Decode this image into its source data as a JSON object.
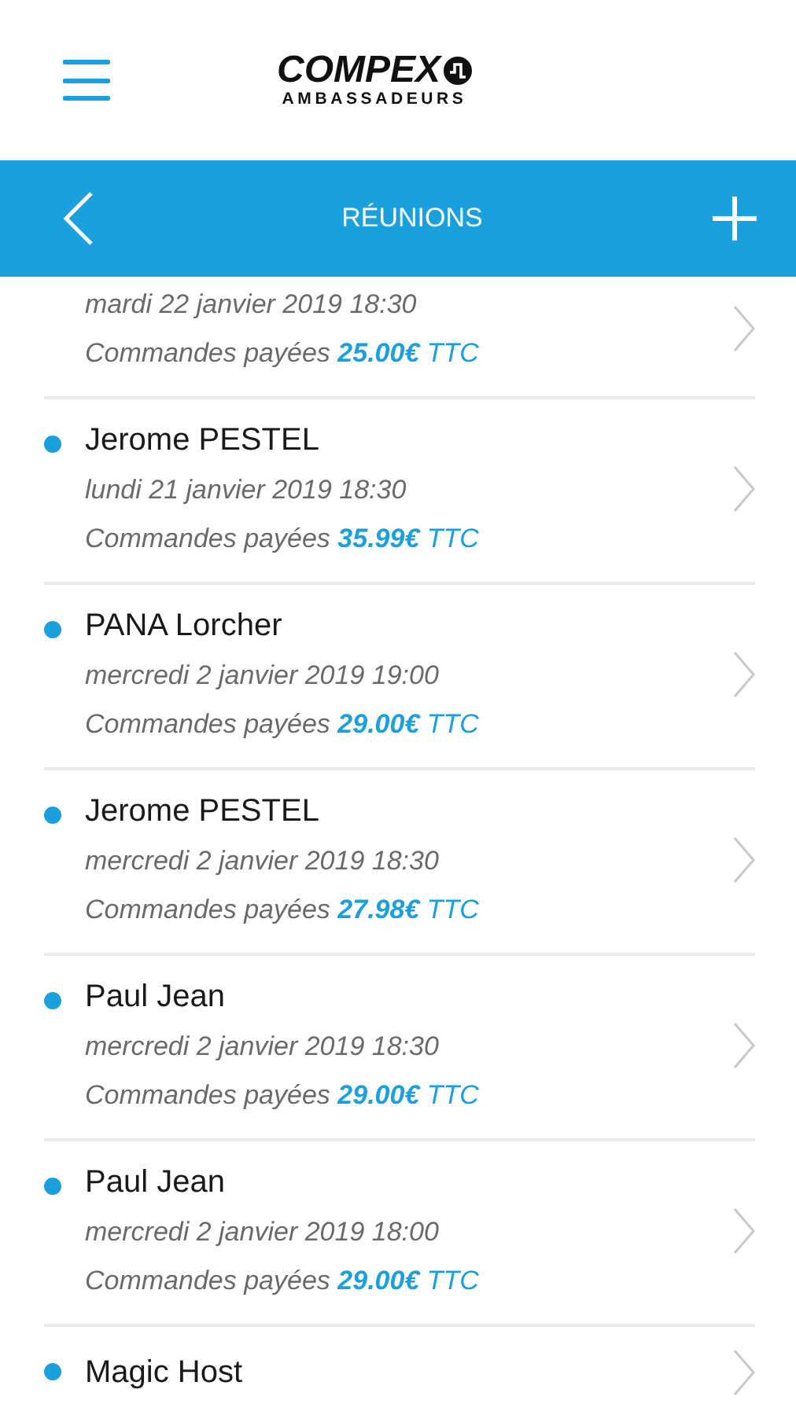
{
  "header": {
    "logo": {
      "wordmark": "COMPEX",
      "tagline": "AMBASSADEURS"
    }
  },
  "navbar": {
    "title": "RÉUNIONS"
  },
  "meetings": [
    {
      "date": "mardi 22 janvier 2019 18:30",
      "total_label": "Commandes payées",
      "amount": "25.00€",
      "suffix": "TTC"
    },
    {
      "name": "Jerome PESTEL",
      "date": "lundi 21 janvier 2019 18:30",
      "total_label": "Commandes payées",
      "amount": "35.99€",
      "suffix": "TTC",
      "marked": true
    },
    {
      "name": "PANA Lorcher",
      "date": "mercredi 2 janvier 2019 19:00",
      "total_label": "Commandes payées",
      "amount": "29.00€",
      "suffix": "TTC",
      "marked": true
    },
    {
      "name": "Jerome PESTEL",
      "date": "mercredi 2 janvier 2019 18:30",
      "total_label": "Commandes payées",
      "amount": "27.98€",
      "suffix": "TTC",
      "marked": true
    },
    {
      "name": "Paul Jean",
      "date": "mercredi 2 janvier 2019 18:30",
      "total_label": "Commandes payées",
      "amount": "29.00€",
      "suffix": "TTC",
      "marked": true
    },
    {
      "name": "Paul Jean",
      "date": "mercredi 2 janvier 2019 18:00",
      "total_label": "Commandes payées",
      "amount": "29.00€",
      "suffix": "TTC",
      "marked": true
    },
    {
      "name": "Magic Host",
      "marked": true
    }
  ]
}
